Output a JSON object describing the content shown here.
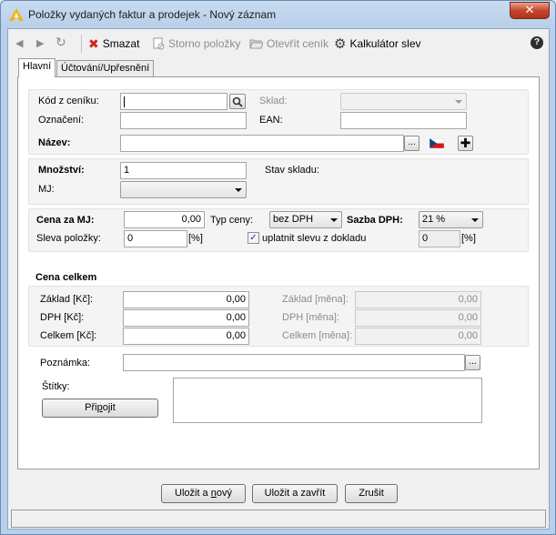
{
  "window": {
    "title": "Položky vydaných faktur a prodejek - Nový záznam",
    "close_label": "✕"
  },
  "toolbar": {
    "nav_back": "◀",
    "nav_forward": "▶",
    "refresh": "↻",
    "delete_label": "Smazat",
    "storno_label": "Storno položky",
    "open_pricelist_label": "Otevřít ceník",
    "discount_calc_label": "Kalkulátor slev",
    "help_label": "?"
  },
  "tabs": [
    {
      "label": "Hlavní",
      "active": true
    },
    {
      "label": "Účtování/Upřesnění",
      "active": false
    }
  ],
  "form": {
    "kod_label": "Kód z ceníku:",
    "kod_value": "",
    "sklad_label": "Sklad:",
    "sklad_value": "",
    "oznaceni_label": "Označení:",
    "oznaceni_value": "",
    "ean_label": "EAN:",
    "ean_value": "",
    "nazev_label": "Název:",
    "nazev_value": "",
    "mnozstvi_label": "Množství:",
    "mnozstvi_value": "1",
    "stav_skladu_label": "Stav skladu:",
    "mj_label": "MJ:",
    "mj_value": "",
    "cena_mj_label": "Cena za MJ:",
    "cena_mj_value": "0,00",
    "typ_ceny_label": "Typ ceny:",
    "typ_ceny_value": "bez DPH",
    "sazba_dph_label": "Sazba DPH:",
    "sazba_dph_value": "21 %",
    "sleva_label": "Sleva položky:",
    "sleva_value": "0",
    "sleva_unit": "[%]",
    "uplatnit_label": "uplatnit slevu z dokladu",
    "uplatnit_checked": true,
    "doklad_sleva_value": "0",
    "doklad_sleva_unit": "[%]",
    "cena_celkem_title": "Cena celkem",
    "zaklad_kc_label": "Základ [Kč]:",
    "zaklad_kc_value": "0,00",
    "dph_kc_label": "DPH [Kč]:",
    "dph_kc_value": "0,00",
    "celkem_kc_label": "Celkem [Kč]:",
    "celkem_kc_value": "0,00",
    "zaklad_mena_label": "Základ [měna]:",
    "zaklad_mena_value": "0,00",
    "dph_mena_label": "DPH [měna]:",
    "dph_mena_value": "0,00",
    "celkem_mena_label": "Celkem [měna]:",
    "celkem_mena_value": "0,00",
    "poznamka_label": "Poznámka:",
    "poznamka_value": "",
    "stitky_label": "Štítky:",
    "pripojit_label": "Připojit",
    "ellipsis": "..."
  },
  "footer": {
    "save_new_label": "Uložit a nový",
    "save_close_label": "Uložit a zavřít",
    "cancel_label": "Zrušit"
  },
  "colors": {
    "delete_red": "#d0261b",
    "flag_red": "#d7141a",
    "flag_blue": "#11457e",
    "title_bg": "#b9d0ea"
  }
}
